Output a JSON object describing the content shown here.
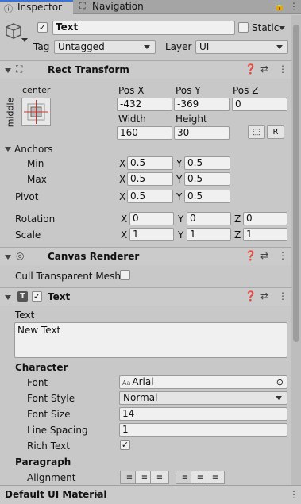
{
  "tabs": [
    {
      "label": "Inspector",
      "icon": "info-icon"
    },
    {
      "label": "Navigation",
      "icon": "navigation-icon"
    }
  ],
  "object": {
    "name": "Text",
    "static_label": "Static",
    "tag_label": "Tag",
    "tag_value": "Untagged",
    "layer_label": "Layer",
    "layer_value": "UI"
  },
  "rect_transform": {
    "title": "Rect Transform",
    "anchor_preset_h": "center",
    "anchor_preset_v": "middle",
    "pos_x_label": "Pos X",
    "pos_x": "-432",
    "pos_y_label": "Pos Y",
    "pos_y": "-369",
    "pos_z_label": "Pos Z",
    "pos_z": "0",
    "width_label": "Width",
    "width": "160",
    "height_label": "Height",
    "height": "30",
    "r_button": "R",
    "anchors_label": "Anchors",
    "min_label": "Min",
    "min_x": "0.5",
    "min_y": "0.5",
    "max_label": "Max",
    "max_x": "0.5",
    "max_y": "0.5",
    "pivot_label": "Pivot",
    "pivot_x": "0.5",
    "pivot_y": "0.5",
    "rotation_label": "Rotation",
    "rot_x": "0",
    "rot_y": "0",
    "rot_z": "0",
    "scale_label": "Scale",
    "scale_x": "1",
    "scale_y": "1",
    "scale_z": "1",
    "x": "X",
    "y": "Y",
    "z": "Z"
  },
  "canvas_renderer": {
    "title": "Canvas Renderer",
    "cull_label": "Cull Transparent Mesh"
  },
  "text_component": {
    "title": "Text",
    "text_label": "Text",
    "text_value": "New Text",
    "character_label": "Character",
    "font_label": "Font",
    "font_value": "Arial",
    "font_prefix": "Aa",
    "font_style_label": "Font Style",
    "font_style_value": "Normal",
    "font_size_label": "Font Size",
    "font_size_value": "14",
    "line_spacing_label": "Line Spacing",
    "line_spacing_value": "1",
    "rich_text_label": "Rich Text",
    "rich_text_check": "✓",
    "paragraph_label": "Paragraph",
    "alignment_label": "Alignment"
  },
  "footer": {
    "material": "Default UI Material"
  },
  "colors": {
    "panel": "#c8c8c8",
    "tab_bar": "#a5a5a5",
    "field": "#f0f0f0",
    "anchor_red": "#d23030"
  }
}
